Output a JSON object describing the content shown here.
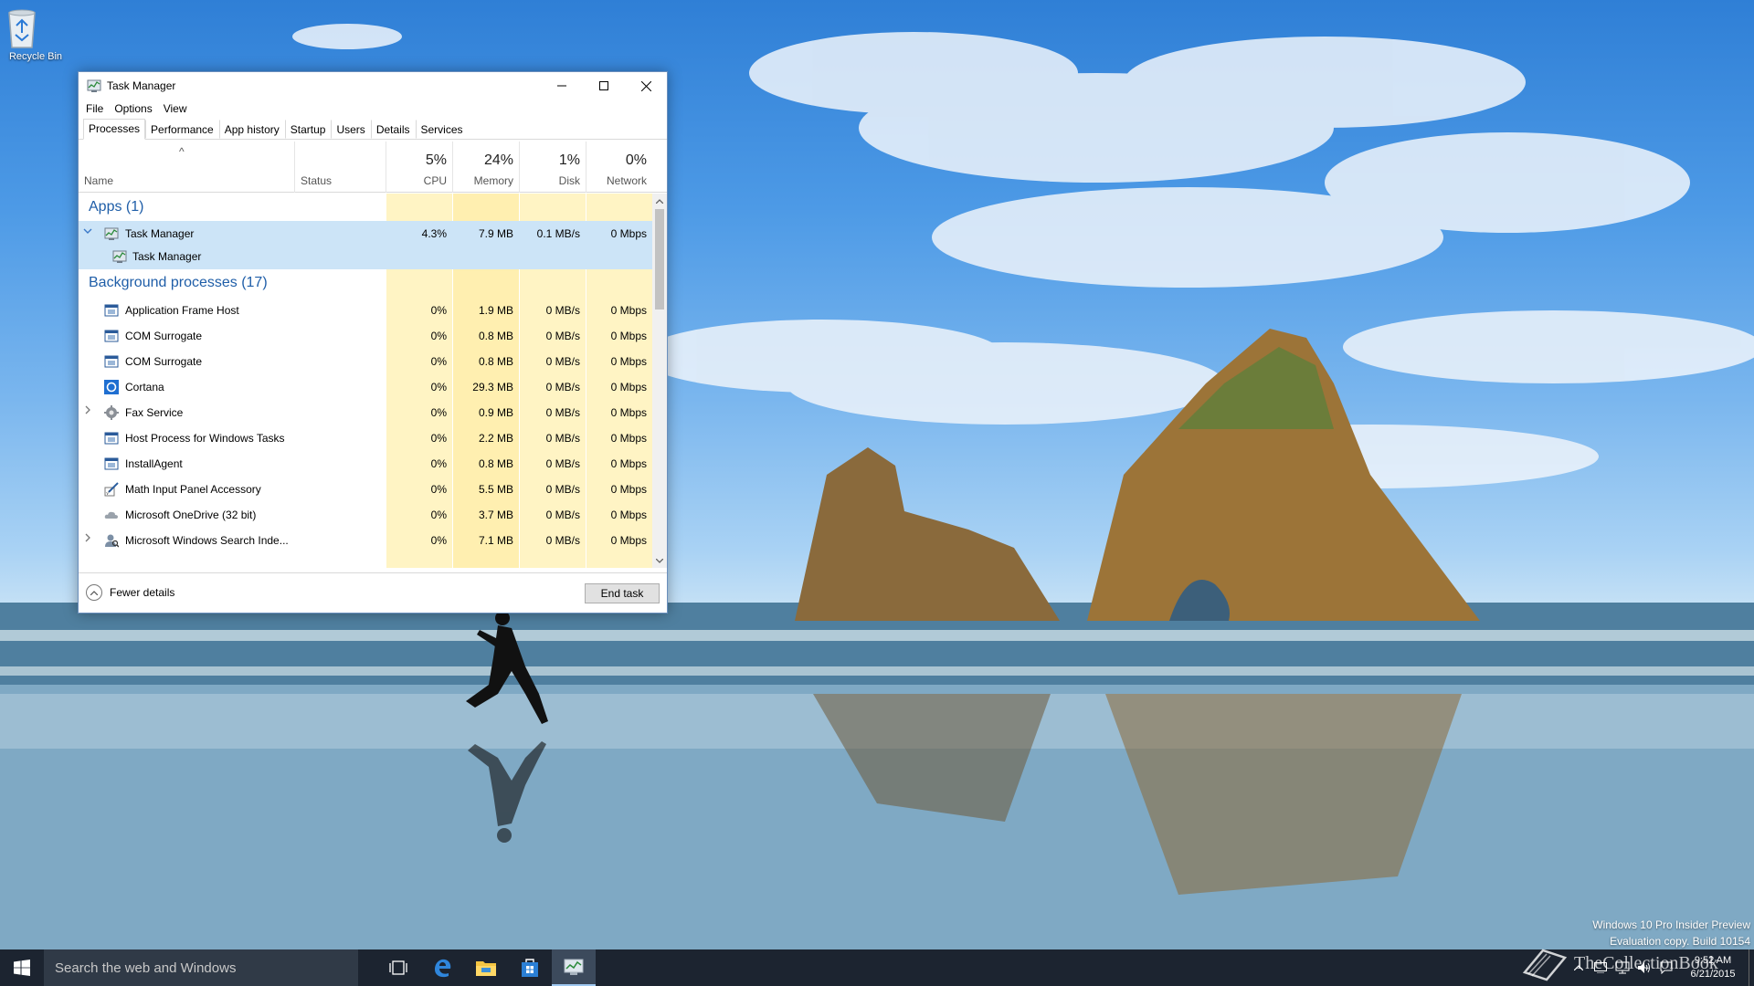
{
  "desktop": {
    "recycle_bin_label": "Recycle Bin",
    "watermark": {
      "line1": "Windows 10 Pro Insider Preview",
      "line2": "Evaluation copy. Build 10154"
    },
    "brand_text": "TheCollectionBook"
  },
  "window": {
    "title": "Task Manager",
    "menu": [
      "File",
      "Options",
      "View"
    ],
    "tabs": [
      "Processes",
      "Performance",
      "App history",
      "Startup",
      "Users",
      "Details",
      "Services"
    ],
    "active_tab": "Processes",
    "columns": {
      "name": "Name",
      "status": "Status",
      "cpu": {
        "percent": "5%",
        "label": "CPU"
      },
      "memory": {
        "percent": "24%",
        "label": "Memory"
      },
      "disk": {
        "percent": "1%",
        "label": "Disk"
      },
      "network": {
        "percent": "0%",
        "label": "Network"
      }
    },
    "groups": {
      "apps": "Apps (1)",
      "background": "Background processes (17)"
    },
    "apps": [
      {
        "name": "Task Manager",
        "cpu": "4.3%",
        "memory": "7.9 MB",
        "disk": "0.1 MB/s",
        "network": "0 Mbps",
        "expanded": true,
        "icon": "task-manager-icon"
      }
    ],
    "app_children": [
      {
        "name": "Task Manager",
        "icon": "task-manager-icon"
      }
    ],
    "background": [
      {
        "name": "Application Frame Host",
        "cpu": "0%",
        "memory": "1.9 MB",
        "disk": "0 MB/s",
        "network": "0 Mbps",
        "icon": "service-window-icon",
        "expandable": false
      },
      {
        "name": "COM Surrogate",
        "cpu": "0%",
        "memory": "0.8 MB",
        "disk": "0 MB/s",
        "network": "0 Mbps",
        "icon": "service-window-icon",
        "expandable": false
      },
      {
        "name": "COM Surrogate",
        "cpu": "0%",
        "memory": "0.8 MB",
        "disk": "0 MB/s",
        "network": "0 Mbps",
        "icon": "service-window-icon",
        "expandable": false
      },
      {
        "name": "Cortana",
        "cpu": "0%",
        "memory": "29.3 MB",
        "disk": "0 MB/s",
        "network": "0 Mbps",
        "icon": "cortana-icon",
        "expandable": false
      },
      {
        "name": "Fax Service",
        "cpu": "0%",
        "memory": "0.9 MB",
        "disk": "0 MB/s",
        "network": "0 Mbps",
        "icon": "gear-service-icon",
        "expandable": true
      },
      {
        "name": "Host Process for Windows Tasks",
        "cpu": "0%",
        "memory": "2.2 MB",
        "disk": "0 MB/s",
        "network": "0 Mbps",
        "icon": "service-window-icon",
        "expandable": false
      },
      {
        "name": "InstallAgent",
        "cpu": "0%",
        "memory": "0.8 MB",
        "disk": "0 MB/s",
        "network": "0 Mbps",
        "icon": "service-window-icon",
        "expandable": false
      },
      {
        "name": "Math Input Panel Accessory",
        "cpu": "0%",
        "memory": "5.5 MB",
        "disk": "0 MB/s",
        "network": "0 Mbps",
        "icon": "math-pen-icon",
        "expandable": false
      },
      {
        "name": "Microsoft OneDrive (32 bit)",
        "cpu": "0%",
        "memory": "3.7 MB",
        "disk": "0 MB/s",
        "network": "0 Mbps",
        "icon": "onedrive-cloud-icon",
        "expandable": false
      },
      {
        "name": "Microsoft Windows Search Inde...",
        "cpu": "0%",
        "memory": "7.1 MB",
        "disk": "0 MB/s",
        "network": "0 Mbps",
        "icon": "search-indexer-icon",
        "expandable": true
      }
    ],
    "footer": {
      "fewer_details": "Fewer details",
      "end_task": "End task"
    }
  },
  "taskbar": {
    "search_placeholder": "Search the web and Windows",
    "clock_time": "9:52 AM",
    "clock_date": "6/21/2015",
    "pinned": [
      "task-view-icon",
      "edge-icon",
      "file-explorer-icon",
      "store-icon",
      "task-manager-icon"
    ]
  },
  "colors": {
    "group_title": "#1f5ea8",
    "selection": "#cce4f7",
    "heat_light": "#fff4c4",
    "taskbar": "#1c2430"
  }
}
